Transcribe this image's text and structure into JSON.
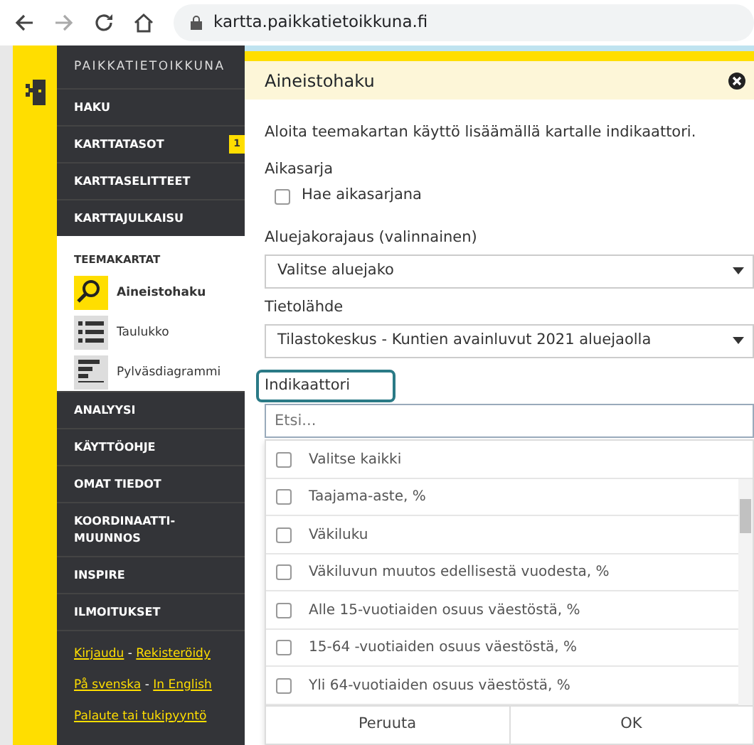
{
  "browser": {
    "url": "kartta.paikkatietoikkuna.fi"
  },
  "sidebar": {
    "logo_text": "PAIKKATIETOIKKUNA",
    "menu_top": [
      {
        "label": "HAKU"
      },
      {
        "label": "KARTTATASOT",
        "badge": "1"
      },
      {
        "label": "KARTTASELITTEET"
      },
      {
        "label": "KARTTAJULKAISU"
      }
    ],
    "theme_maps": {
      "title": "TEEMAKARTAT",
      "items": [
        {
          "label": "Aineistohaku",
          "kind": "search",
          "selected": true
        },
        {
          "label": "Taulukko",
          "kind": "table",
          "selected": false
        },
        {
          "label": "Pylväsdiagrammi",
          "kind": "bars",
          "selected": false
        }
      ]
    },
    "menu_bottom": [
      {
        "label": "ANALYYSI"
      },
      {
        "label": "KÄYTTÖOHJE"
      },
      {
        "label": "OMAT TIEDOT"
      },
      {
        "label": "KOORDINAATTI-MUUNNOS"
      },
      {
        "label": "INSPIRE"
      },
      {
        "label": "ILMOITUKSET"
      }
    ],
    "links": [
      [
        {
          "kind": "link",
          "text": "Kirjaudu"
        },
        {
          "kind": "sep",
          "text": "-"
        },
        {
          "kind": "link",
          "text": "Rekisteröidy"
        }
      ],
      [
        {
          "kind": "link",
          "text": "På svenska"
        },
        {
          "kind": "sep",
          "text": "-"
        },
        {
          "kind": "link",
          "text": "In English"
        }
      ],
      [
        {
          "kind": "link",
          "text": "Palaute tai tukipyyntö"
        }
      ]
    ]
  },
  "panel": {
    "title": "Aineistohaku",
    "intro": "Aloita teemakartan käyttö lisäämällä kartalle indikaattori.",
    "timeseries": {
      "label": "Aikasarja",
      "checkbox_label": "Hae aikasarjana",
      "checked": false
    },
    "region": {
      "label": "Aluejakorajaus (valinnainen)",
      "value": "Valitse aluejako"
    },
    "source": {
      "label": "Tietolähde",
      "value": "Tilastokeskus - Kuntien avainluvut 2021 aluejaolla"
    },
    "indicator": {
      "label": "Indikaattori",
      "highlighted": true,
      "placeholder": "Etsi..."
    },
    "list": {
      "select_all": {
        "label": "Valitse kaikki",
        "checked": false
      },
      "items": [
        {
          "label": "Taajama-aste, %",
          "checked": false
        },
        {
          "label": "Väkiluku",
          "checked": false
        },
        {
          "label": "Väkiluvun muutos edellisestä vuodesta, %",
          "checked": false
        },
        {
          "label": "Alle 15-vuotiaiden osuus väestöstä, %",
          "checked": false
        },
        {
          "label": "15-64 -vuotiaiden osuus väestöstä, %",
          "checked": false
        },
        {
          "label": "Yli 64-vuotiaiden osuus väestöstä, %",
          "checked": false
        }
      ]
    },
    "buttons": [
      "Peruuta",
      "OK"
    ]
  }
}
